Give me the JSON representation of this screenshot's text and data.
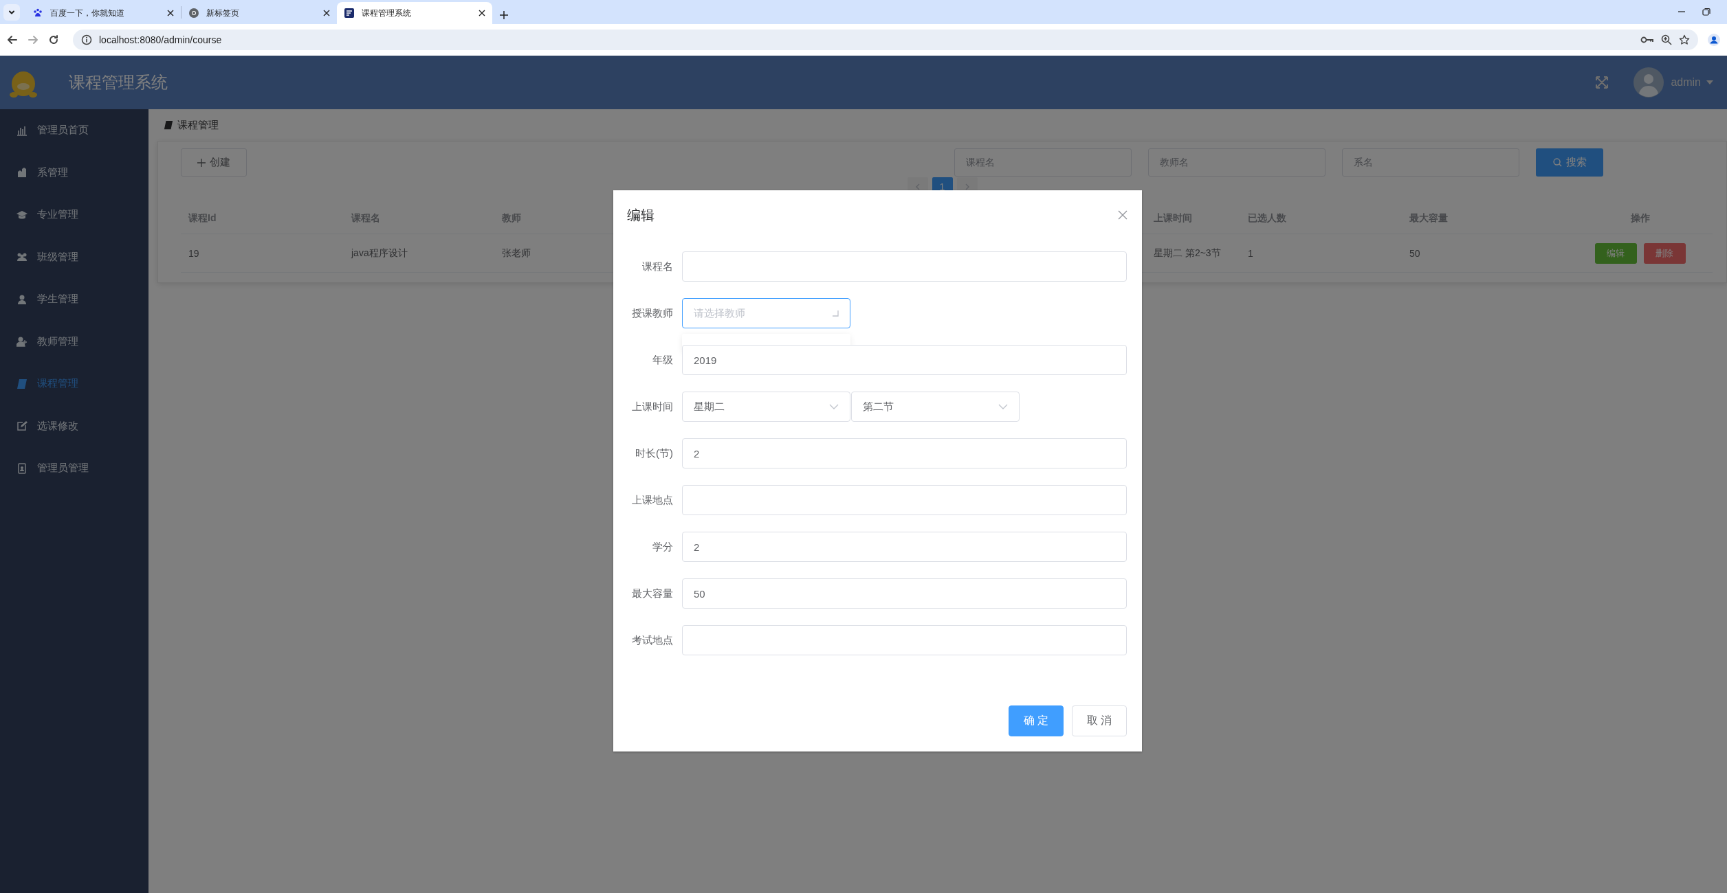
{
  "browser": {
    "tabs": [
      {
        "title": "百度一下，你就知道",
        "selected": false
      },
      {
        "title": "新标签页",
        "selected": false
      },
      {
        "title": "课程管理系统",
        "selected": true
      }
    ],
    "url": "localhost:8080/admin/course"
  },
  "header": {
    "title": "课程管理系统",
    "user": "admin"
  },
  "sidebar": {
    "items": [
      {
        "label": "管理员首页",
        "selected": false
      },
      {
        "label": "系管理",
        "selected": false
      },
      {
        "label": "专业管理",
        "selected": false
      },
      {
        "label": "班级管理",
        "selected": false
      },
      {
        "label": "学生管理",
        "selected": false
      },
      {
        "label": "教师管理",
        "selected": false
      },
      {
        "label": "课程管理",
        "selected": true
      },
      {
        "label": "选课修改",
        "selected": false
      },
      {
        "label": "管理员管理",
        "selected": false
      }
    ]
  },
  "breadcrumb": "课程管理",
  "toolbar": {
    "create_button": "创建",
    "search_fields": [
      {
        "placeholder": "课程名"
      },
      {
        "placeholder": "教师名"
      },
      {
        "placeholder": "系名"
      }
    ],
    "search_button": "搜索"
  },
  "pagination": {
    "pages": [
      {
        "label": "1",
        "selected": true
      }
    ]
  },
  "table": {
    "columns": [
      "课程Id",
      "课程名",
      "教师",
      "上课时间",
      "已选人数",
      "最大容量",
      "操作"
    ],
    "rows": [
      {
        "cells": [
          "19",
          "java程序设计",
          "张老师",
          "星期二 第2~3节",
          "1",
          "50"
        ],
        "actions": [
          {
            "label": "编辑",
            "kind": "edit"
          },
          {
            "label": "删除",
            "kind": "delete"
          }
        ]
      }
    ]
  },
  "dialog": {
    "title": "编辑",
    "fields": [
      {
        "label": "课程名",
        "kind": "input",
        "focused": false
      },
      {
        "label": "授课教师",
        "kind": "select",
        "placeholder": "请选择教师",
        "focused": true
      },
      {
        "label": "年级",
        "kind": "input",
        "value": "2019",
        "focused": false
      },
      {
        "label": "上课时间",
        "kind": "select_pair",
        "selects": [
          {
            "value": "星期二"
          },
          {
            "value": "第二节"
          }
        ],
        "focused": false
      },
      {
        "label": "时长(节)",
        "kind": "input",
        "value": "2",
        "focused": false
      },
      {
        "label": "上课地点",
        "kind": "input",
        "focused": false
      },
      {
        "label": "学分",
        "kind": "input",
        "value": "2",
        "focused": false
      },
      {
        "label": "最大容量",
        "kind": "input",
        "value": "50",
        "focused": false
      },
      {
        "label": "考试地点",
        "kind": "input",
        "focused": false
      }
    ],
    "buttons": [
      {
        "label": "确 定",
        "kind": "primary"
      },
      {
        "label": "取 消",
        "kind": "default"
      }
    ]
  }
}
